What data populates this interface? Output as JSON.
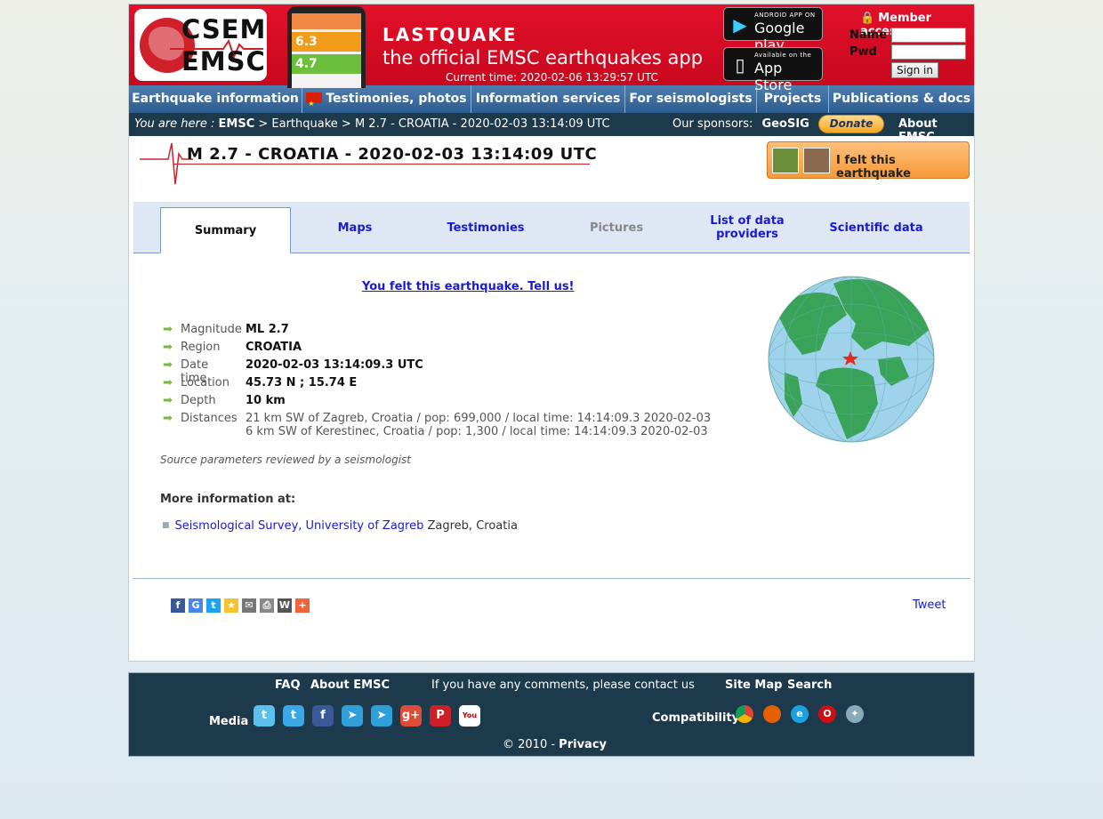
{
  "header": {
    "logo_line1": "CSEM",
    "logo_line2": "EMSC",
    "app_title": "LASTQUAKE",
    "app_subtitle": "the official EMSC earthquakes app",
    "current_time": "Current time: 2020-02-06 13:29:57 UTC",
    "google_play_small": "ANDROID APP ON",
    "google_play_big": "Google play",
    "app_store_small": "Available on the",
    "app_store_big": "App Store",
    "member_access": "Member access",
    "name_label": "Name",
    "pwd_label": "Pwd",
    "sign_in": "Sign in",
    "phone_values": [
      "6.3",
      "4.7"
    ]
  },
  "nav": {
    "items": [
      "Earthquake information",
      "Testimonies, photos",
      "Information services",
      "For seismologists",
      "Projects",
      "Publications & docs"
    ]
  },
  "breadcrumb": {
    "you_are_here": "You are here :",
    "emsc": "EMSC",
    "path": " > Earthquake > M 2.7 - CROATIA - 2020-02-03 13:14:09 UTC",
    "sponsors_label": "Our sponsors:",
    "sponsor": "GeoSIG",
    "donate": "Donate",
    "about": "About EMSC"
  },
  "event": {
    "title": "M 2.7 - CROATIA - 2020-02-03 13:14:09 UTC",
    "felt_button": "I felt this earthquake",
    "tell_us": "You felt this earthquake. Tell us!",
    "details": [
      {
        "key": "Magnitude",
        "value": "ML 2.7"
      },
      {
        "key": "Region",
        "value": "CROATIA"
      },
      {
        "key": "Date time",
        "value": "2020-02-03 13:14:09.3 UTC"
      },
      {
        "key": "Location",
        "value": "45.73 N ; 15.74 E"
      },
      {
        "key": "Depth",
        "value": "10 km"
      }
    ],
    "distances_label": "Distances",
    "distance1": "21 km SW of Zagreb, Croatia / pop: 699,000 / local time: 14:14:09.3 2020-02-03",
    "distance2": "6 km SW of Kerestinec, Croatia / pop: 1,300 / local time: 14:14:09.3 2020-02-03",
    "reviewed": "Source parameters reviewed by a seismologist",
    "more_info_header": "More information at:",
    "more_info_link": "Seismological Survey, University of Zagreb",
    "more_info_place": " Zagreb, Croatia"
  },
  "tabs": [
    {
      "label": "Summary",
      "state": "active"
    },
    {
      "label": "Maps",
      "state": "link"
    },
    {
      "label": "Testimonies",
      "state": "link"
    },
    {
      "label": "Pictures",
      "state": "disabled"
    },
    {
      "label": "List of data providers",
      "state": "link"
    },
    {
      "label": "Scientific data",
      "state": "link"
    }
  ],
  "share": {
    "icons": [
      "facebook-icon",
      "google-icon",
      "twitter-icon",
      "favorite-icon",
      "email-icon",
      "print-icon",
      "wordpress-icon",
      "more-icon"
    ],
    "tweet": "Tweet"
  },
  "footer": {
    "faq": "FAQ",
    "about": "About EMSC",
    "comments": "If you have any comments, please contact us",
    "sitemap": "Site Map",
    "search": "Search",
    "media_label": "Media :",
    "compat_label": "Compatibility :",
    "copyright": "© 2010 - ",
    "privacy": "Privacy"
  },
  "colors": {
    "banner_red": "#d80c24",
    "nav_blue": "#3b6b9c",
    "dark_bar": "#1d3a4c",
    "link_blue": "#1a1ad6",
    "felt_orange": "#f69a3a"
  }
}
